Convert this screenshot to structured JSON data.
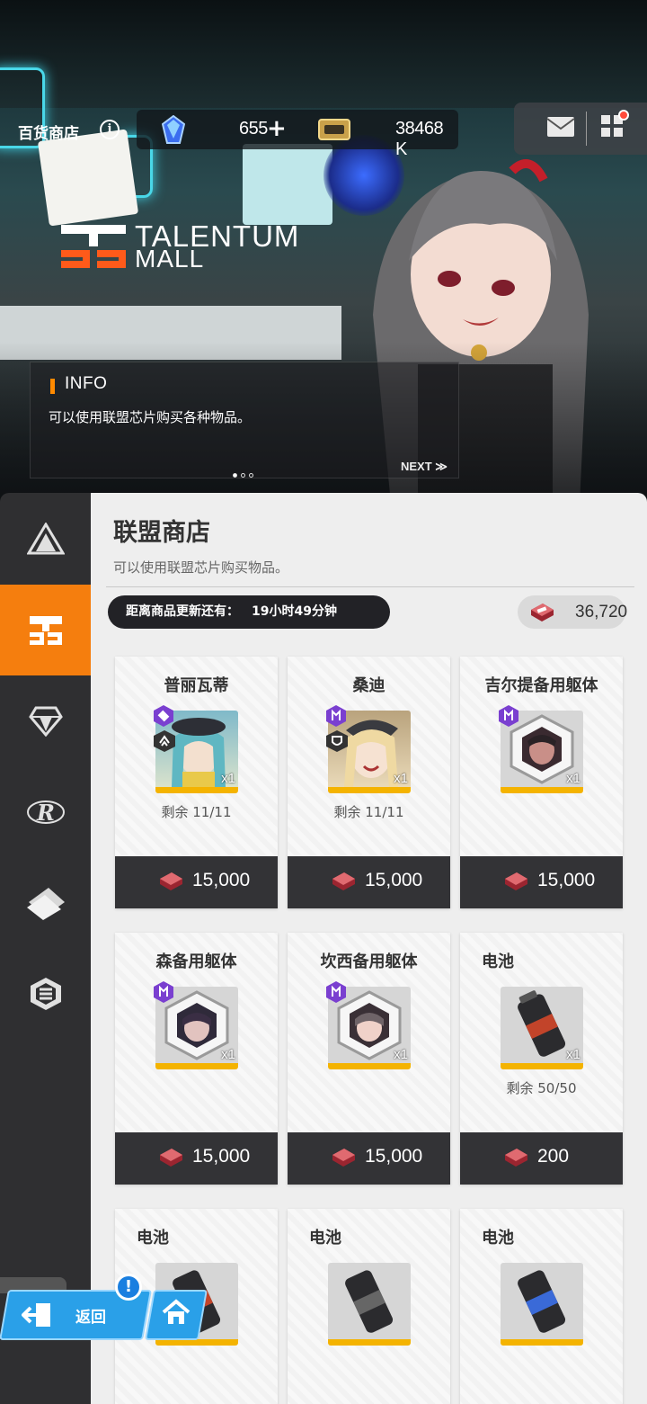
{
  "header": {
    "shop_title": "百货商店",
    "info_icon": "i",
    "gems": "655",
    "plus": "+",
    "credits": "38468 K"
  },
  "banner": {
    "logo_line1": "TALENTUM",
    "logo_line2": "MALL",
    "info_heading": "INFO",
    "info_text": "可以使用联盟芯片购买各种物品。",
    "next_label": "NEXT ≫",
    "page_indicator": {
      "current": 1,
      "total": 3
    }
  },
  "sidebar": {
    "items": [
      {
        "icon": "pyramid-icon"
      },
      {
        "icon": "union-shop-icon",
        "active": true
      },
      {
        "icon": "diamond-icon"
      },
      {
        "icon": "r-emblem-icon"
      },
      {
        "icon": "ticket-icon"
      },
      {
        "icon": "hex-badge-icon"
      }
    ]
  },
  "shop": {
    "title": "联盟商店",
    "description": "可以使用联盟芯片购买物品。",
    "refresh_label": "距离商品更新还有：",
    "refresh_time": "19小时49分钟",
    "chip_balance": "36,720"
  },
  "items": [
    {
      "name": "普丽瓦蒂",
      "qty": "x1",
      "remaining": "剩余 11/11",
      "price": "15,000"
    },
    {
      "name": "桑迪",
      "qty": "x1",
      "remaining": "剩余 11/11",
      "price": "15,000"
    },
    {
      "name": "吉尔提备用躯体",
      "qty": "x1",
      "remaining": "",
      "price": "15,000"
    },
    {
      "name": "森备用躯体",
      "qty": "x1",
      "remaining": "",
      "price": "15,000"
    },
    {
      "name": "坎西备用躯体",
      "qty": "x1",
      "remaining": "",
      "price": "15,000"
    },
    {
      "name": "电池",
      "qty": "x1",
      "remaining": "剩余 50/50",
      "price": "200"
    },
    {
      "name": "电池",
      "qty": "",
      "remaining": "",
      "price": ""
    },
    {
      "name": "电池",
      "qty": "",
      "remaining": "",
      "price": ""
    },
    {
      "name": "电池",
      "qty": "",
      "remaining": "",
      "price": ""
    }
  ],
  "bottom_nav": {
    "back_label": "返回",
    "alert": "!"
  },
  "colors": {
    "accent": "#f57e0e",
    "price_bar": "#333336",
    "nav_button": "#2aa0e8",
    "rarity_purple": "#7a3fd0",
    "quantity_bar": "#f4b300"
  }
}
